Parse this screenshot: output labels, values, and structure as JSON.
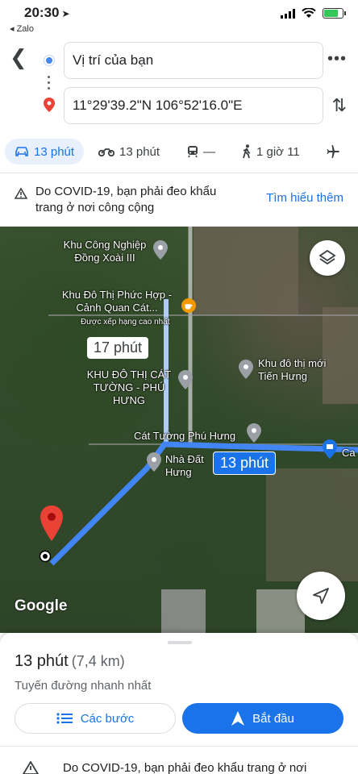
{
  "status_bar": {
    "time": "20:30",
    "back_app": "◂ Zalo"
  },
  "route": {
    "origin": "Vị trí của bạn",
    "destination": "11°29'39.2\"N 106°52'16.0\"E"
  },
  "modes": [
    {
      "name": "car",
      "label": "13 phút"
    },
    {
      "name": "motorbike",
      "label": "13 phút"
    },
    {
      "name": "transit",
      "label": "—"
    },
    {
      "name": "walk",
      "label": "1 giờ 11"
    },
    {
      "name": "flight",
      "label": ""
    }
  ],
  "covid": {
    "text": "Do COVID-19, bạn phải đeo khẩu trang ở nơi công cộng",
    "learn_more": "Tìm hiểu thêm"
  },
  "map": {
    "labels": {
      "kcn": "Khu Công Nghiệp Đồng Xoài III",
      "kdt_phuc": "Khu Đô Thị Phức Hợp - Cảnh Quan Cát...",
      "kdt_phuc_sub": "Được xếp hạng cao nhất",
      "kdt_cat_tuong": "KHU ĐÔ THỊ CÁT TƯỜNG - PHÚ HƯNG",
      "kdt_tien_hung": "Khu đô thị mới Tiến Hưng",
      "cat_tuong_phu_hung": "Cát Tường Phú Hưng",
      "nha_dat_hung": "Nhà Đất Hưng",
      "ca": "Ca"
    },
    "alt_route_time": "17 phút",
    "best_route_time": "13 phút",
    "logo": "Google"
  },
  "sheet": {
    "duration": "13 phút",
    "distance": "(7,4 km)",
    "subtitle": "Tuyến đường nhanh nhất",
    "steps_label": "Các bước",
    "start_label": "Bắt đầu",
    "warning": "Do COVID-19, bạn phải đeo khẩu trang ở nơi"
  },
  "colors": {
    "accent": "#1a73e8",
    "route": "#4285f4",
    "pin": "#ea4335"
  }
}
